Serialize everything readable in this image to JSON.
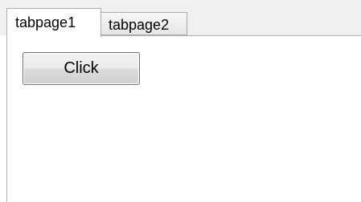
{
  "tabs": [
    {
      "label": "tabpage1",
      "selected": true
    },
    {
      "label": "tabpage2",
      "selected": false
    }
  ],
  "panel": {
    "button_label": "Click"
  }
}
